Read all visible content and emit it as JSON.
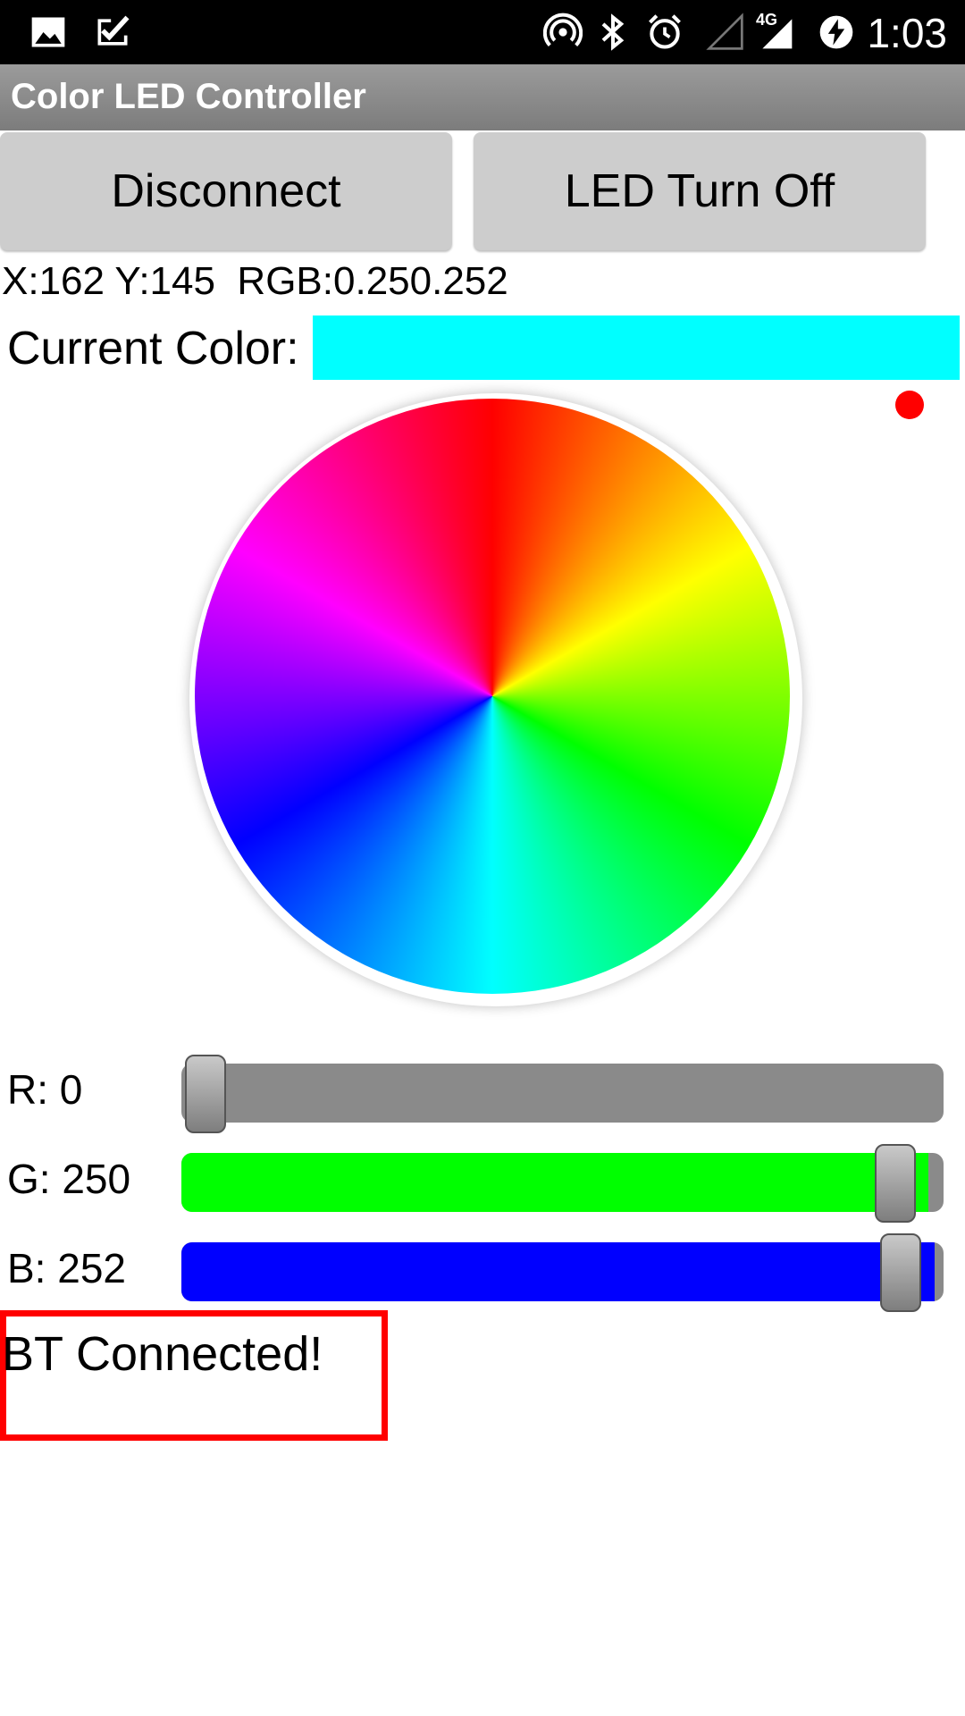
{
  "status_bar": {
    "time": "1:03",
    "icons": [
      "image-icon",
      "check-task-icon",
      "hotspot-icon",
      "bluetooth-icon",
      "alarm-icon",
      "signal-icon",
      "network-4g-icon",
      "battery-charging-icon"
    ],
    "network_label": "4G"
  },
  "app": {
    "title": "Color LED Controller"
  },
  "buttons": {
    "disconnect": "Disconnect",
    "led_off": "LED Turn Off"
  },
  "readout": {
    "text": "X:162 Y:145  RGB:0.250.252"
  },
  "current_color": {
    "label": "Current Color:",
    "value": "#00ffff"
  },
  "indicator": {
    "color": "#ff0000"
  },
  "sliders": [
    {
      "label": "R: 0",
      "value": 0,
      "max": 255,
      "fill_color": "#8a8a8a"
    },
    {
      "label": "G: 250",
      "value": 250,
      "max": 255,
      "fill_color": "#00ff00"
    },
    {
      "label": "B: 252",
      "value": 252,
      "max": 255,
      "fill_color": "#0000ff"
    }
  ],
  "status": {
    "text": "BT Connected!",
    "border_color": "#ff0000"
  }
}
